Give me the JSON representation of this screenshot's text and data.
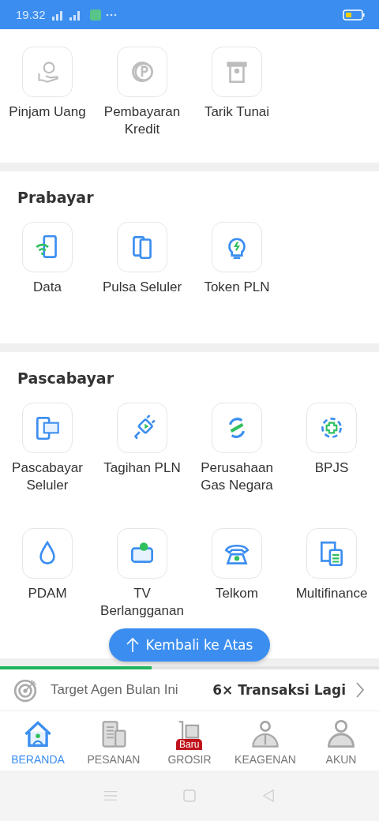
{
  "status_bar": {
    "time": "19.32"
  },
  "sections": [
    {
      "items": [
        {
          "label": "Pinjam Uang",
          "disabled": true
        },
        {
          "label": "Pembayaran Kredit",
          "disabled": true
        },
        {
          "label": "Tarik Tunai",
          "disabled": true
        }
      ]
    },
    {
      "title": "Prabayar",
      "items": [
        {
          "label": "Data",
          "disabled": false
        },
        {
          "label": "Pulsa Seluler",
          "disabled": false
        },
        {
          "label": "Token PLN",
          "disabled": false
        }
      ]
    },
    {
      "title": "Pascabayar",
      "items": [
        {
          "label": "Pascabayar Seluler",
          "disabled": false
        },
        {
          "label": "Tagihan PLN",
          "disabled": false
        },
        {
          "label": "Perusahaan Gas Negara",
          "disabled": false
        },
        {
          "label": "BPJS",
          "disabled": false
        },
        {
          "label": "PDAM",
          "disabled": false
        },
        {
          "label": "TV Berlangganan",
          "disabled": false
        },
        {
          "label": "Telkom",
          "disabled": false
        },
        {
          "label": "Multifinance",
          "disabled": false
        }
      ]
    }
  ],
  "back_to_top_button": "Kembali ke Atas",
  "target": {
    "level": 0.4,
    "label": "Target Agen Bulan Ini",
    "value": "6× Transaksi Lagi"
  },
  "bottom_nav": [
    {
      "label": "BERANDA",
      "selected": true
    },
    {
      "label": "PESANAN",
      "selected": false
    },
    {
      "label": "GROSIR",
      "selected": false,
      "badge": "Baru"
    },
    {
      "label": "KEAGENAN",
      "selected": false
    },
    {
      "label": "AKUN",
      "selected": false
    }
  ]
}
